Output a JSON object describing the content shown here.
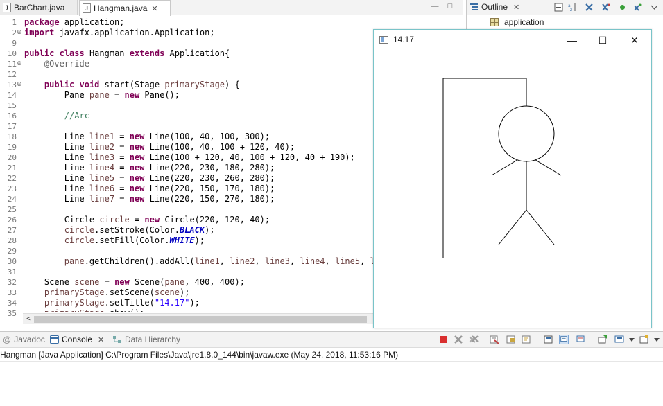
{
  "editor": {
    "tabs": [
      {
        "label": "BarChart.java",
        "active": false
      },
      {
        "label": "Hangman.java",
        "active": true
      }
    ],
    "tab_close_glyph": "✕",
    "minimize_glyph": "—",
    "maximize_glyph": "□",
    "line_numbers": [
      "1",
      "2",
      "9",
      "10",
      "11",
      "12",
      "13",
      "14",
      "15",
      "16",
      "17",
      "18",
      "19",
      "20",
      "21",
      "22",
      "23",
      "24",
      "25",
      "26",
      "27",
      "28",
      "29",
      "30",
      "31",
      "32",
      "33",
      "34",
      "35"
    ],
    "code_lines": [
      [
        {
          "t": "package",
          "c": "kw"
        },
        {
          "t": " application;",
          "c": ""
        }
      ],
      [
        {
          "t": "import",
          "c": "kw"
        },
        {
          "t": " javafx.application.Application;",
          "c": ""
        }
      ],
      [],
      [
        {
          "t": "public",
          "c": "kw"
        },
        {
          "t": " ",
          "c": ""
        },
        {
          "t": "class",
          "c": "kw"
        },
        {
          "t": " Hangman ",
          "c": ""
        },
        {
          "t": "extends",
          "c": "kw"
        },
        {
          "t": " Application{",
          "c": ""
        }
      ],
      [
        {
          "t": "    ",
          "c": ""
        },
        {
          "t": "@Override",
          "c": "an"
        }
      ],
      [],
      [
        {
          "t": "    ",
          "c": ""
        },
        {
          "t": "public",
          "c": "kw"
        },
        {
          "t": " ",
          "c": ""
        },
        {
          "t": "void",
          "c": "kw"
        },
        {
          "t": " start(Stage ",
          "c": ""
        },
        {
          "t": "primaryStage",
          "c": "vr"
        },
        {
          "t": ") {",
          "c": ""
        }
      ],
      [
        {
          "t": "        Pane ",
          "c": ""
        },
        {
          "t": "pane",
          "c": "vr"
        },
        {
          "t": " = ",
          "c": ""
        },
        {
          "t": "new",
          "c": "kw"
        },
        {
          "t": " Pane();",
          "c": ""
        }
      ],
      [],
      [
        {
          "t": "        ",
          "c": ""
        },
        {
          "t": "//Arc",
          "c": "cm"
        }
      ],
      [],
      [
        {
          "t": "        Line ",
          "c": ""
        },
        {
          "t": "line1",
          "c": "vr"
        },
        {
          "t": " = ",
          "c": ""
        },
        {
          "t": "new",
          "c": "kw"
        },
        {
          "t": " Line(100, 40, 100, 300);",
          "c": ""
        }
      ],
      [
        {
          "t": "        Line ",
          "c": ""
        },
        {
          "t": "line2",
          "c": "vr"
        },
        {
          "t": " = ",
          "c": ""
        },
        {
          "t": "new",
          "c": "kw"
        },
        {
          "t": " Line(100, 40, 100 + 120, 40);",
          "c": ""
        }
      ],
      [
        {
          "t": "        Line ",
          "c": ""
        },
        {
          "t": "line3",
          "c": "vr"
        },
        {
          "t": " = ",
          "c": ""
        },
        {
          "t": "new",
          "c": "kw"
        },
        {
          "t": " Line(100 + 120, 40, 100 + 120, 40 + 190);",
          "c": ""
        }
      ],
      [
        {
          "t": "        Line ",
          "c": ""
        },
        {
          "t": "line4",
          "c": "vr"
        },
        {
          "t": " = ",
          "c": ""
        },
        {
          "t": "new",
          "c": "kw"
        },
        {
          "t": " Line(220, 230, 180, 280);",
          "c": ""
        }
      ],
      [
        {
          "t": "        Line ",
          "c": ""
        },
        {
          "t": "line5",
          "c": "vr"
        },
        {
          "t": " = ",
          "c": ""
        },
        {
          "t": "new",
          "c": "kw"
        },
        {
          "t": " Line(220, 230, 260, 280);",
          "c": ""
        }
      ],
      [
        {
          "t": "        Line ",
          "c": ""
        },
        {
          "t": "line6",
          "c": "vr"
        },
        {
          "t": " = ",
          "c": ""
        },
        {
          "t": "new",
          "c": "kw"
        },
        {
          "t": " Line(220, 150, 170, 180);",
          "c": ""
        }
      ],
      [
        {
          "t": "        Line ",
          "c": ""
        },
        {
          "t": "line7",
          "c": "vr"
        },
        {
          "t": " = ",
          "c": ""
        },
        {
          "t": "new",
          "c": "kw"
        },
        {
          "t": " Line(220, 150, 270, 180);",
          "c": ""
        }
      ],
      [],
      [
        {
          "t": "        Circle ",
          "c": ""
        },
        {
          "t": "circle",
          "c": "vr"
        },
        {
          "t": " = ",
          "c": ""
        },
        {
          "t": "new",
          "c": "kw"
        },
        {
          "t": " Circle(220, 120, 40);",
          "c": ""
        }
      ],
      [
        {
          "t": "        ",
          "c": ""
        },
        {
          "t": "circle",
          "c": "vr"
        },
        {
          "t": ".setStroke(Color.",
          "c": ""
        },
        {
          "t": "BLACK",
          "c": "fi"
        },
        {
          "t": ");",
          "c": ""
        }
      ],
      [
        {
          "t": "        ",
          "c": ""
        },
        {
          "t": "circle",
          "c": "vr"
        },
        {
          "t": ".setFill(Color.",
          "c": ""
        },
        {
          "t": "WHITE",
          "c": "fi"
        },
        {
          "t": ");",
          "c": ""
        }
      ],
      [],
      [
        {
          "t": "        ",
          "c": ""
        },
        {
          "t": "pane",
          "c": "vr"
        },
        {
          "t": ".getChildren().addAll(",
          "c": ""
        },
        {
          "t": "line1",
          "c": "vr"
        },
        {
          "t": ", ",
          "c": ""
        },
        {
          "t": "line2",
          "c": "vr"
        },
        {
          "t": ", ",
          "c": ""
        },
        {
          "t": "line3",
          "c": "vr"
        },
        {
          "t": ", ",
          "c": ""
        },
        {
          "t": "line4",
          "c": "vr"
        },
        {
          "t": ", ",
          "c": ""
        },
        {
          "t": "line5",
          "c": "vr"
        },
        {
          "t": ", ",
          "c": ""
        },
        {
          "t": "lin",
          "c": "vr"
        }
      ],
      [],
      [
        {
          "t": "    Scene ",
          "c": ""
        },
        {
          "t": "scene",
          "c": "vr"
        },
        {
          "t": " = ",
          "c": ""
        },
        {
          "t": "new",
          "c": "kw"
        },
        {
          "t": " Scene(",
          "c": ""
        },
        {
          "t": "pane",
          "c": "vr"
        },
        {
          "t": ", 400, 400);",
          "c": ""
        }
      ],
      [
        {
          "t": "    ",
          "c": ""
        },
        {
          "t": "primaryStage",
          "c": "vr"
        },
        {
          "t": ".setScene(",
          "c": ""
        },
        {
          "t": "scene",
          "c": "vr"
        },
        {
          "t": ");",
          "c": ""
        }
      ],
      [
        {
          "t": "    ",
          "c": ""
        },
        {
          "t": "primaryStage",
          "c": "vr"
        },
        {
          "t": ".setTitle(",
          "c": ""
        },
        {
          "t": "\"14.17\"",
          "c": "st"
        },
        {
          "t": ");",
          "c": ""
        }
      ],
      [
        {
          "t": "    ",
          "c": ""
        },
        {
          "t": "primaryStage",
          "c": "vr"
        },
        {
          "t": ".show();",
          "c": ""
        }
      ]
    ],
    "hscroll_left_glyph": "<"
  },
  "outline": {
    "tab_label": "Outline",
    "close_glyph": "✕",
    "item_label": "application"
  },
  "app_window": {
    "title": "14.17",
    "minimize_glyph": "—",
    "maximize_glyph": "☐",
    "close_glyph": "✕"
  },
  "bottom_panel": {
    "tabs": [
      {
        "label": "Javadoc",
        "active": false
      },
      {
        "label": "Console",
        "active": true
      },
      {
        "label": "Data Hierarchy",
        "active": false
      }
    ],
    "console_close_glyph": "✕",
    "console_text": "Hangman [Java Application] C:\\Program Files\\Java\\jre1.8.0_144\\bin\\javaw.exe (May 24, 2018, 11:53:16 PM)"
  }
}
